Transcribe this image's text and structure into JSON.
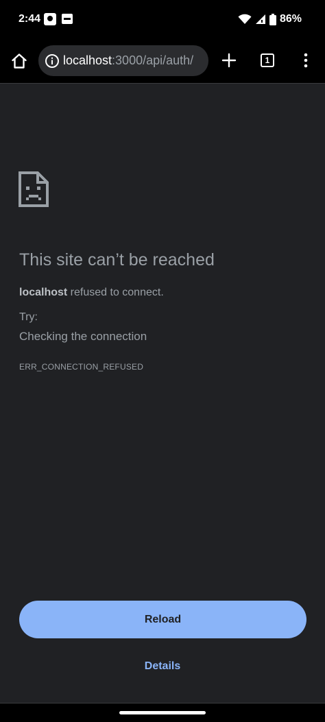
{
  "status_bar": {
    "time": "2:44",
    "battery": "86%"
  },
  "toolbar": {
    "url_host": "localhost",
    "url_path": ":3000/api/auth/",
    "tab_count": "1"
  },
  "error": {
    "title": "This site can’t be reached",
    "host": "localhost",
    "message": " refused to connect.",
    "try_label": "Try:",
    "suggestion": "Checking the connection",
    "code": "ERR_CONNECTION_REFUSED"
  },
  "buttons": {
    "reload_label": "Reload",
    "details_label": "Details"
  },
  "colors": {
    "background": "#202124",
    "accent": "#8ab4f8",
    "text_secondary": "#9aa0a6"
  },
  "icons": {
    "home": "home-icon",
    "info": "info-icon",
    "new_tab": "plus-icon",
    "menu": "more-vert-icon",
    "error_page": "sad-page-icon",
    "wifi": "wifi-icon",
    "signal": "signal-icon",
    "battery": "battery-icon"
  }
}
